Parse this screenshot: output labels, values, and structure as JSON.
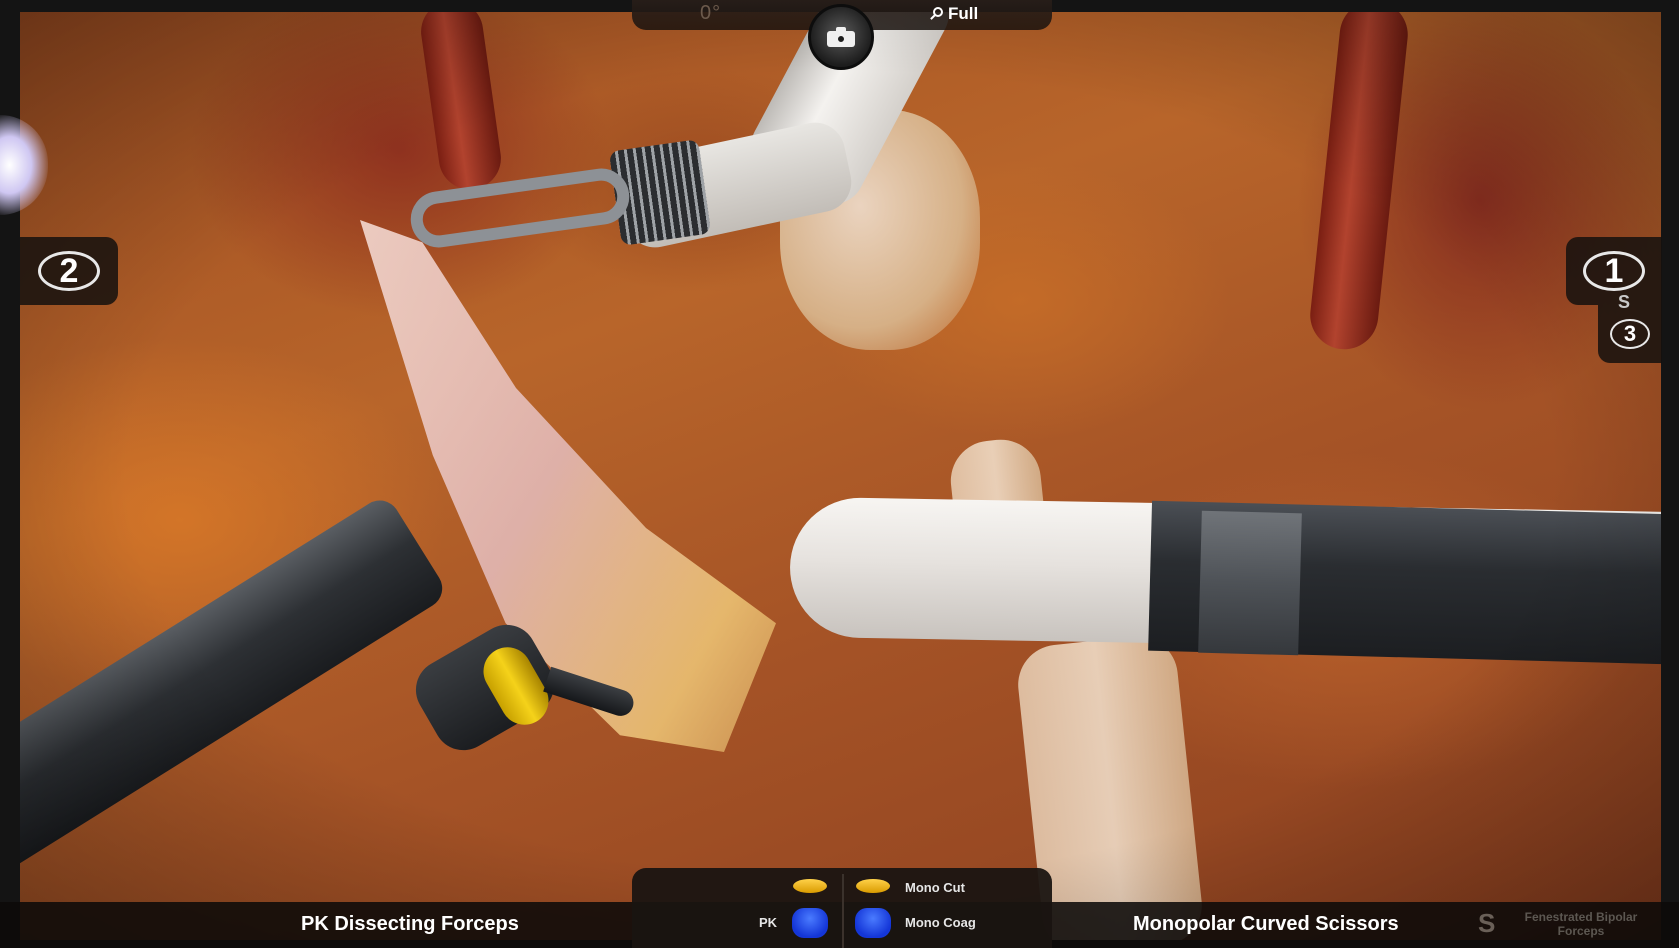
{
  "top_hud": {
    "scope_angle": "0°",
    "zoom_label": "Full"
  },
  "arms": {
    "left_arm_number": "2",
    "right_arm_number": "1",
    "swap_arm_number": "3",
    "swap_glyph": "S"
  },
  "energy_pedals": {
    "mono_cut_label": "Mono Cut",
    "mono_coag_label": "Mono Coag",
    "pk_label": "PK"
  },
  "instruments": {
    "left_name": "PK Dissecting Forceps",
    "right_name": "Monopolar Curved Scissors",
    "third_name": "Fenestrated Bipolar Forceps",
    "swap_glyph": "S"
  },
  "colors": {
    "pedal_yellow": "#f5c12a",
    "pedal_blue": "#1f47f0",
    "hud_background": "#1a1411",
    "text": "#ffffff"
  },
  "icons": [
    "camera-icon",
    "magnifier-icon",
    "swap-arrow-icon"
  ]
}
